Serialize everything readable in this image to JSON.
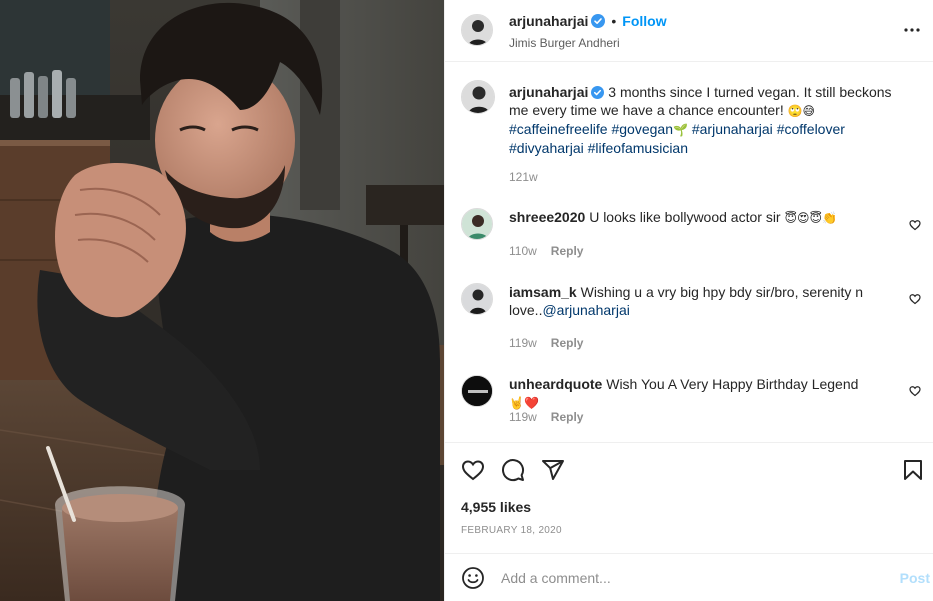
{
  "post": {
    "image": {
      "description_icon": "photo-man-with-cold-coffee"
    },
    "header": {
      "username": "arjunaharjai",
      "verified_icon": "verified-badge-icon",
      "separator": "•",
      "follow_label": "Follow",
      "location": "Jimis Burger Andheri",
      "more_icon": "more-options-icon"
    },
    "caption": {
      "username": "arjunaharjai",
      "text_plain": "3 months since I turned vegan. It still beckons me every time we have a chance encounter!",
      "emojis_1": "🙄😅",
      "tag_1": "#caffeinefreelife",
      "tag_2": "#govegan",
      "emoji_2": "🌱",
      "tag_3": "#arjunaharjai",
      "tag_4": "#coffelover",
      "tag_5": "#divyaharjai",
      "tag_6": "#lifeofamusician",
      "time": "121w"
    },
    "comments": [
      {
        "username": "shreee2020",
        "text": "U looks like bollywood actor sir",
        "emojis": "😇😍😇👏",
        "time": "110w",
        "reply_label": "Reply"
      },
      {
        "username": "iamsam_k",
        "text": "Wishing u a vry big hpy bdy sir/bro, serenity n love..",
        "mention": "@arjunaharjai",
        "time": "119w",
        "reply_label": "Reply"
      },
      {
        "username": "unheardquote",
        "text": "Wish You A Very Happy Birthday Legend",
        "emojis": "🤘❤️",
        "time": "119w",
        "reply_label": "Reply"
      }
    ],
    "actions": {
      "like_icon": "heart-icon",
      "comment_icon": "comment-bubble-icon",
      "share_icon": "paper-plane-share-icon",
      "save_icon": "bookmark-icon"
    },
    "likes": "4,955 likes",
    "date": "FEBRUARY 18, 2020",
    "add_comment": {
      "emoji_icon": "smiley-emoji-icon",
      "placeholder": "Add a comment...",
      "post_label": "Post"
    },
    "colors": {
      "follow": "#0095f6",
      "hashtag": "#00376b",
      "muted": "#8e8e8e",
      "post_disabled": "#b2dffc",
      "verified": "#3897f0"
    }
  }
}
